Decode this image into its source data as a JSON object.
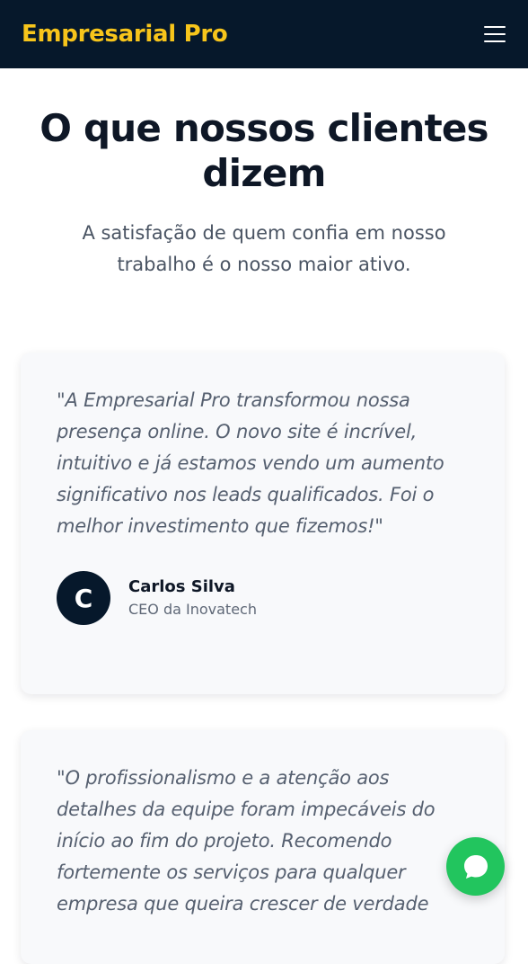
{
  "header": {
    "brand": "Empresarial Pro",
    "menu_icon": "hamburger-menu-icon"
  },
  "section": {
    "title": "O que nossos clientes dizem",
    "subtitle": "A satisfação de quem confia em nosso trabalho é o nosso maior ativo."
  },
  "testimonials": [
    {
      "quote": "\"A Empresarial Pro transformou nossa presença online. O novo site é incrível, intuitivo e já estamos vendo um aumento significativo nos leads qualificados. Foi o melhor investimento que fizemos!\"",
      "initial": "C",
      "name": "Carlos Silva",
      "role": "CEO da Inovatech"
    },
    {
      "quote": "\"O profissionalismo e a atenção aos detalhes da equipe foram impecáveis do início ao fim do projeto. Recomendo fortemente os serviços para qualquer empresa que queira crescer de verdade"
    }
  ],
  "colors": {
    "navbar": "#06182b",
    "brand": "#f7c51b",
    "card_bg": "#f8f9fb",
    "chat_button": "#22c55e"
  },
  "chat_button": {
    "icon": "chat-bubble-icon"
  }
}
